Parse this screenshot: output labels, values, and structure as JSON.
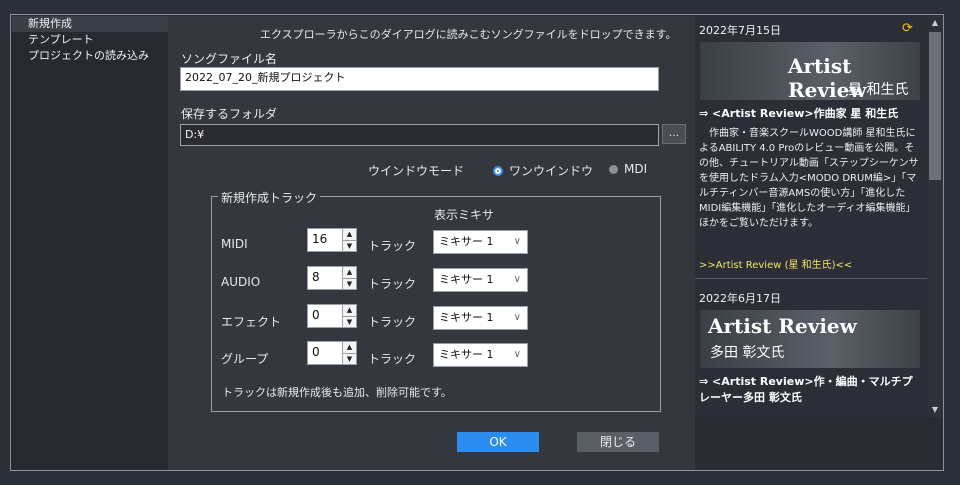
{
  "sidebar": {
    "items": [
      {
        "label": "新規作成"
      },
      {
        "label": "テンプレート"
      },
      {
        "label": "プロジェクトの読み込み"
      }
    ]
  },
  "main": {
    "info_text": "エクスプローラからこのダイアログに読みこむソングファイルをドロップできます。",
    "song_label": "ソングファイル名",
    "song_value": "2022_07_20_新規プロジェクト",
    "folder_label": "保存するフォルダ",
    "folder_value": "D:¥",
    "browse_label": "...",
    "window_mode_label": "ウインドウモード",
    "radio_one_window": "ワンウインドウ",
    "radio_mdi": "MDI",
    "group_title": "新規作成トラック",
    "mixer_header": "表示ミキサ",
    "rows": [
      {
        "label": "MIDI",
        "count": "16",
        "track": "トラック",
        "mixer": "ミキサー 1"
      },
      {
        "label": "AUDIO",
        "count": "8",
        "track": "トラック",
        "mixer": "ミキサー 1"
      },
      {
        "label": "エフェクト",
        "count": "0",
        "track": "トラック",
        "mixer": "ミキサー 1"
      },
      {
        "label": "グループ",
        "count": "0",
        "track": "トラック",
        "mixer": "ミキサー 1"
      }
    ],
    "note": "トラックは新規作成後も追加、削除可能です。",
    "ok_label": "OK",
    "close_label": "閉じる"
  },
  "news": {
    "items": [
      {
        "date": "2022年7月15日",
        "banner_title": "Artist Review",
        "banner_sub": "星 和生氏",
        "headline": "⇒ <Artist Review>作曲家 星 和生氏",
        "body": "　作曲家・音楽スクールWOOD講師 星和生氏によるABILITY 4.0 Proのレビュー動画を公開。その他、チュートリアル動画「ステップシーケンサを使用したドラム入力<MODO DRUM編>」「マルチティンバー音源AMSの使い方」「進化したMIDI編集機能」「進化したオーディオ編集機能」ほかをご覧いただけます。",
        "link": ">>Artist Review (星 和生氏)<<"
      },
      {
        "date": "2022年6月17日",
        "banner_title": "Artist Review",
        "banner_sub": "多田 彰文氏",
        "headline": "⇒ <Artist Review>作・編曲・マルチプレーヤー多田 彰文氏"
      }
    ]
  }
}
